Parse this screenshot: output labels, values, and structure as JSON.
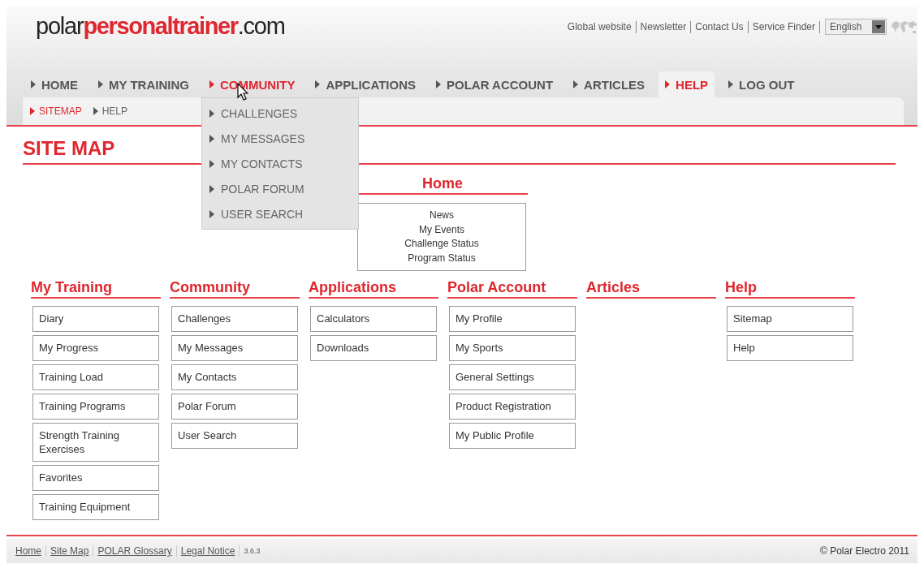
{
  "logo": {
    "prefix": "polar",
    "brand": "personaltrainer",
    "suffix": ".com"
  },
  "top_links": [
    "Global website",
    "Newsletter",
    "Contact Us",
    "Service Finder"
  ],
  "language": {
    "value": "English"
  },
  "nav": [
    {
      "label": "HOME",
      "selected": false,
      "expanded": false
    },
    {
      "label": "MY TRAINING",
      "selected": false,
      "expanded": false
    },
    {
      "label": "COMMUNITY",
      "selected": false,
      "expanded": true,
      "menu": [
        "CHALLENGES",
        "MY MESSAGES",
        "MY CONTACTS",
        "POLAR FORUM",
        "USER SEARCH"
      ]
    },
    {
      "label": "APPLICATIONS",
      "selected": false,
      "expanded": false
    },
    {
      "label": "POLAR ACCOUNT",
      "selected": false,
      "expanded": false
    },
    {
      "label": "ARTICLES",
      "selected": false,
      "expanded": false
    },
    {
      "label": "HELP",
      "selected": true,
      "expanded": false
    },
    {
      "label": "LOG OUT",
      "selected": false,
      "expanded": false
    }
  ],
  "subnav": [
    {
      "label": "SITEMAP",
      "selected": true
    },
    {
      "label": "HELP",
      "selected": false
    }
  ],
  "page_title": "SITE MAP",
  "home": {
    "title": "Home",
    "links": [
      "News",
      "My Events",
      "Challenge Status",
      "Program Status"
    ]
  },
  "sections": [
    {
      "title": "My Training",
      "links": [
        "Diary",
        "My Progress",
        "Training Load",
        "Training Programs",
        "Strength Training Exercises",
        "Favorites",
        "Training Equipment"
      ]
    },
    {
      "title": "Community",
      "links": [
        "Challenges",
        "My Messages",
        "My Contacts",
        "Polar Forum",
        "User Search"
      ]
    },
    {
      "title": "Applications",
      "links": [
        "Calculators",
        "Downloads"
      ]
    },
    {
      "title": "Polar Account",
      "links": [
        "My Profile",
        "My Sports",
        "General Settings",
        "Product Registration",
        "My Public Profile"
      ]
    },
    {
      "title": "Articles"
    },
    {
      "title": "Help",
      "links": [
        "Sitemap",
        "Help"
      ]
    }
  ],
  "footer": {
    "links": [
      "Home",
      "Site Map",
      "POLAR Glossary",
      "Legal Notice"
    ],
    "version": "3.6.3",
    "copyright": "© Polar Electro 2011"
  }
}
